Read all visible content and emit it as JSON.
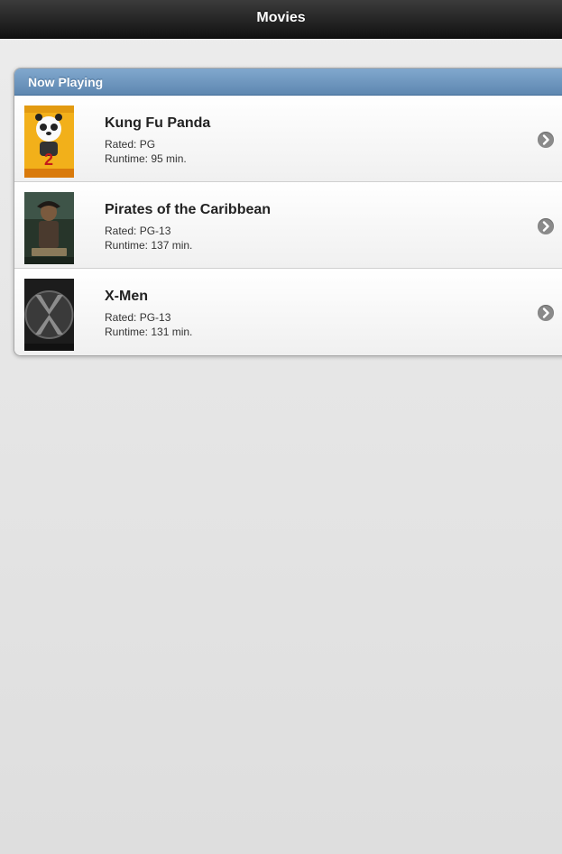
{
  "header": {
    "title": "Movies"
  },
  "list": {
    "divider": "Now Playing",
    "items": [
      {
        "title": "Kung Fu Panda",
        "rating": "Rated: PG",
        "runtime": "Runtime: 95 min.",
        "poster_icon": "kung-fu-panda-poster"
      },
      {
        "title": "Pirates of the Caribbean",
        "rating": "Rated: PG-13",
        "runtime": "Runtime: 137 min.",
        "poster_icon": "pirates-poster"
      },
      {
        "title": "X-Men",
        "rating": "Rated: PG-13",
        "runtime": "Runtime: 131 min.",
        "poster_icon": "x-men-poster"
      }
    ]
  },
  "colors": {
    "header_bg": "#1a1a1a",
    "divider_bg": "#6f97bf",
    "arrow_bg": "#8a8a8a"
  }
}
